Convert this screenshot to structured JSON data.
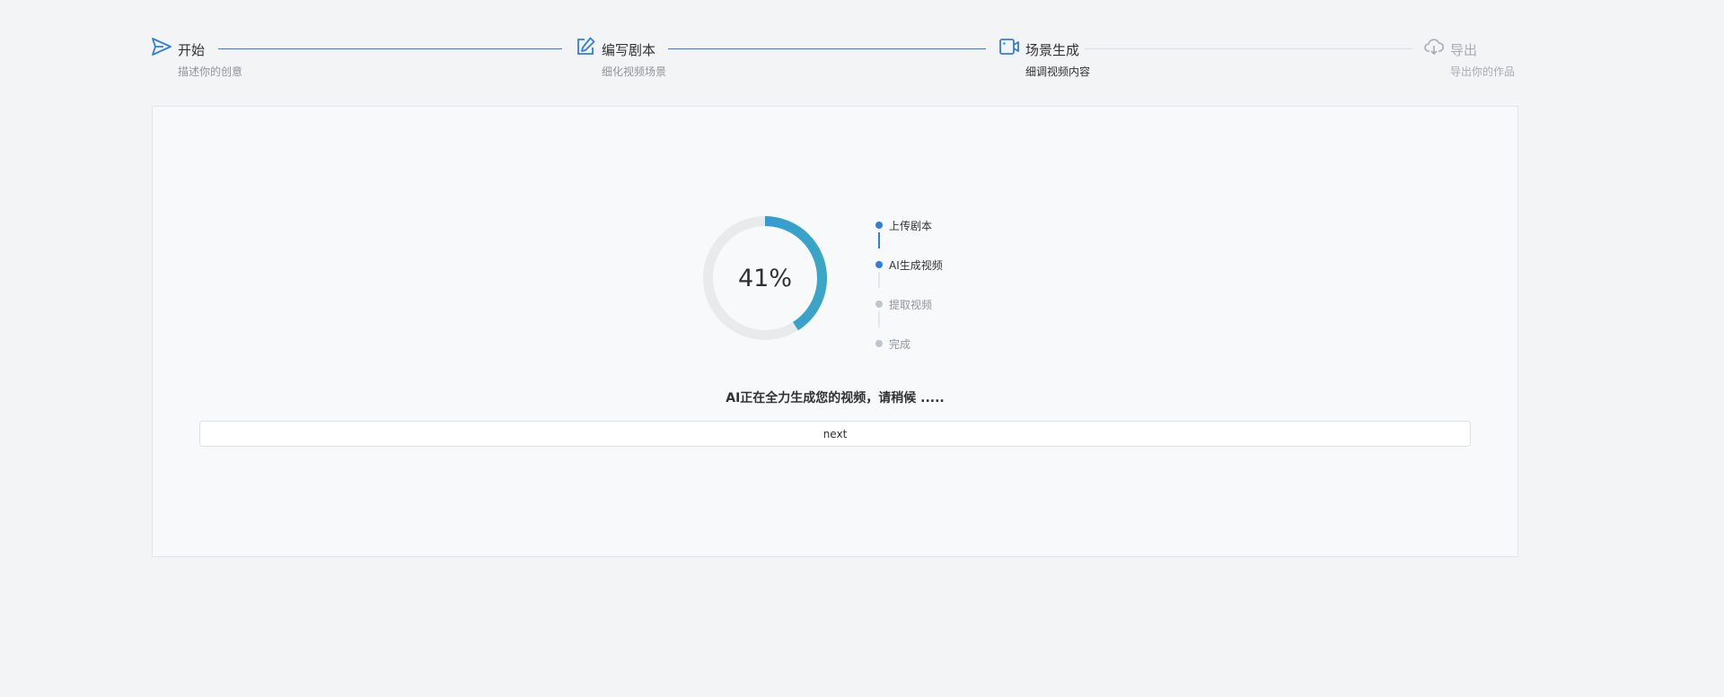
{
  "steps": [
    {
      "title": "开始",
      "desc": "描述你的创意",
      "icon": "send-icon",
      "state": "done"
    },
    {
      "title": "编写剧本",
      "desc": "细化视频场景",
      "icon": "edit-icon",
      "state": "done"
    },
    {
      "title": "场景生成",
      "desc": "细调视频内容",
      "icon": "video-camera-icon",
      "state": "active"
    },
    {
      "title": "导出",
      "desc": "导出你的作品",
      "icon": "cloud-download-icon",
      "state": "wait"
    }
  ],
  "progress": {
    "percent": 41,
    "label": "41%"
  },
  "timeline": [
    {
      "label": "上传剧本",
      "state": "done"
    },
    {
      "label": "AI生成视频",
      "state": "done"
    },
    {
      "label": "提取视频",
      "state": "todo"
    },
    {
      "label": "完成",
      "state": "todo"
    }
  ],
  "status_text": "AI正在全力生成您的视频，请稍候 .....",
  "next_button": "next",
  "colors": {
    "accent": "#2f7ee2",
    "ring_start": "#2f8fe0",
    "ring_end": "#3ba6c5",
    "ring_track": "#e9eaec",
    "inactive": "#a8abb2"
  }
}
